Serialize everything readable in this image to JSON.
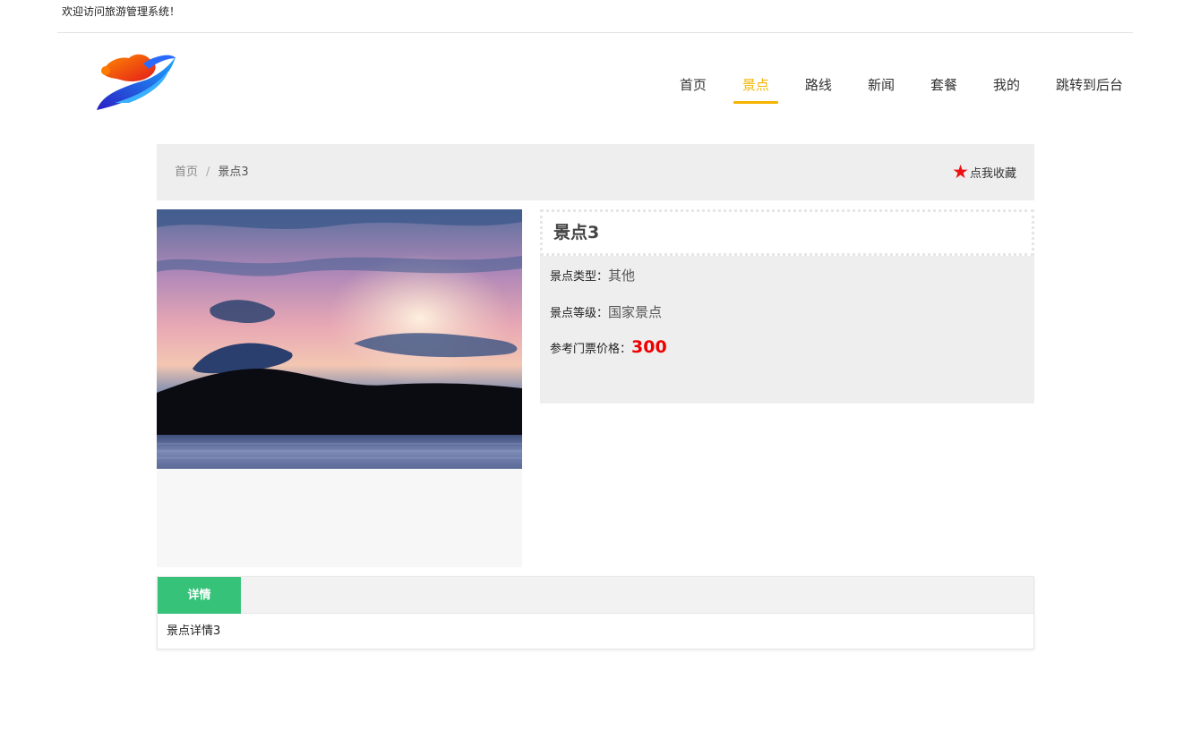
{
  "topbar": {
    "welcome": "欢迎访问旅游管理系统！"
  },
  "nav": {
    "items": [
      {
        "label": "首页"
      },
      {
        "label": "景点"
      },
      {
        "label": "路线"
      },
      {
        "label": "新闻"
      },
      {
        "label": "套餐"
      },
      {
        "label": "我的"
      },
      {
        "label": "跳转到后台"
      }
    ],
    "active_label": "景点",
    "accent_color": "#f4b400"
  },
  "breadcrumb": {
    "home": "首页",
    "separator": "/",
    "current": "景点3"
  },
  "favorite": {
    "icon": "star-icon",
    "label": "点我收藏",
    "icon_color": "#ee1111"
  },
  "spot": {
    "title": "景点3",
    "type_label": "景点类型：",
    "type_value": "其他",
    "level_label": "景点等级：",
    "level_value": "国家景点",
    "price_label": "参考门票价格：",
    "price_value": "300",
    "price_color": "#ee0000"
  },
  "tabs": {
    "items": [
      {
        "label": "详情"
      }
    ],
    "active_color": "#36c279",
    "content": "景点详情3"
  }
}
